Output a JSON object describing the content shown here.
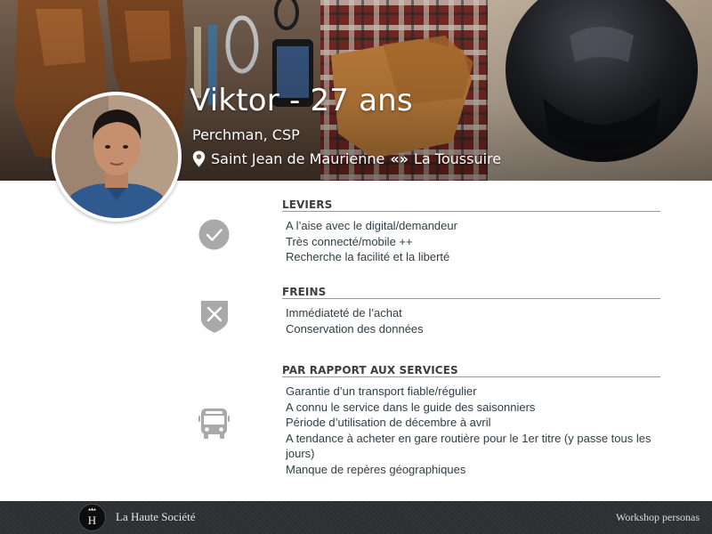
{
  "persona": {
    "name": "Viktor - 27 ans",
    "occupation": "Perchman, CSP",
    "location_from": "Saint Jean de Maurienne",
    "location_separator": "«»",
    "location_to": "La Toussuire",
    "location_icon": "map-pin-icon"
  },
  "sections": {
    "leviers": {
      "title": "LEVIERS",
      "icon": "checkmark-icon",
      "items": [
        "A l’aise avec le digital/demandeur",
        "Très connecté/mobile ++",
        "Recherche la facilité et la liberté"
      ]
    },
    "freins": {
      "title": "FREINS",
      "icon": "shield-cross-icon",
      "items": [
        "Immédiateté de l’achat",
        "Conservation des données"
      ]
    },
    "services": {
      "title": "PAR RAPPORT AUX SERVICES",
      "icon": "bus-icon",
      "items": [
        "Garantie d’un transport fiable/régulier",
        "A connu le service dans le guide des saisonniers",
        "Période d’utilisation de décembre à avril",
        "A tendance à acheter en gare routière pour le 1er titre (y passe tous les jours)",
        "Manque de repères géographiques"
      ]
    }
  },
  "footer": {
    "brand": "La Haute Société",
    "logo_letter": "H",
    "right_label": "Workshop personas"
  },
  "colors": {
    "section_text": "#2f3e46",
    "section_title": "#3e3e3e",
    "icon_gray": "#a9a9a9",
    "footer_bg": "#2d2f33"
  }
}
